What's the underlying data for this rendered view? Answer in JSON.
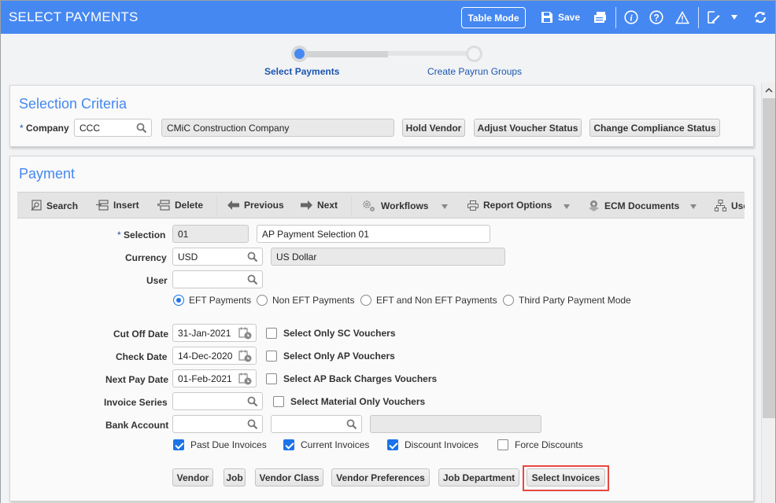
{
  "header": {
    "title": "SELECT PAYMENTS",
    "table_mode_label": "Table Mode",
    "save_label": "Save",
    "icons": [
      "save-icon",
      "print-icon",
      "info-icon",
      "help-icon",
      "warning-icon",
      "edit-icon",
      "dropdown-icon",
      "refresh-icon"
    ]
  },
  "stepper": {
    "steps": [
      {
        "label": "Select Payments",
        "active": true
      },
      {
        "label": "Create Payrun Groups",
        "active": false
      }
    ]
  },
  "selection_criteria": {
    "title": "Selection Criteria",
    "company_label": "Company",
    "company_required": "*",
    "company_code": "CCC",
    "company_name": "CMiC Construction Company",
    "buttons": [
      "Hold Vendor",
      "Adjust Voucher Status",
      "Change Compliance Status"
    ]
  },
  "payment": {
    "title": "Payment",
    "toolbar": {
      "items": [
        {
          "label": "Search",
          "icon": "search-record-icon"
        },
        {
          "label": "Insert",
          "icon": "insert-icon"
        },
        {
          "label": "Delete",
          "icon": "delete-icon"
        },
        {
          "label": "Previous",
          "icon": "arrow-left-icon"
        },
        {
          "label": "Next",
          "icon": "arrow-right-icon"
        },
        {
          "label": "Workflows",
          "icon": "gears-icon"
        },
        {
          "label": "Report Options",
          "icon": "printer-icon"
        },
        {
          "label": "ECM Documents",
          "icon": "ecm-icon"
        },
        {
          "label": "Use",
          "icon": "hierarchy-icon"
        }
      ]
    },
    "fields": {
      "selection": {
        "label": "Selection",
        "required": "*",
        "code": "01",
        "description": "AP Payment Selection 01"
      },
      "currency": {
        "label": "Currency",
        "code": "USD",
        "description": "US Dollar"
      },
      "user": {
        "label": "User",
        "value": ""
      },
      "cut_off_date": {
        "label": "Cut Off Date",
        "value": "31-Jan-2021"
      },
      "check_date": {
        "label": "Check Date",
        "value": "14-Dec-2020"
      },
      "next_pay_date": {
        "label": "Next Pay Date",
        "value": "01-Feb-2021"
      },
      "invoice_series": {
        "label": "Invoice Series",
        "value": ""
      },
      "bank_account": {
        "label": "Bank Account",
        "value": "",
        "value2": "",
        "description": ""
      }
    },
    "payment_mode": {
      "options": [
        "EFT Payments",
        "Non EFT Payments",
        "EFT and Non EFT Payments",
        "Third Party Payment Mode"
      ],
      "selected": "EFT Payments"
    },
    "voucher_checkboxes": [
      {
        "label": "Select Only SC Vouchers",
        "checked": false
      },
      {
        "label": "Select Only AP Vouchers",
        "checked": false
      },
      {
        "label": "Select AP Back Charges Vouchers",
        "checked": false
      },
      {
        "label": "Select Material Only Vouchers",
        "checked": false
      }
    ],
    "invoice_checkboxes": [
      {
        "label": "Past Due Invoices",
        "checked": true
      },
      {
        "label": "Current Invoices",
        "checked": true
      },
      {
        "label": "Discount Invoices",
        "checked": true
      },
      {
        "label": "Force Discounts",
        "checked": false
      }
    ],
    "buttons": [
      "Vendor",
      "Job",
      "Vendor Class",
      "Vendor Preferences",
      "Job Department",
      "Select Invoices"
    ],
    "highlighted_button": "Select Invoices"
  }
}
